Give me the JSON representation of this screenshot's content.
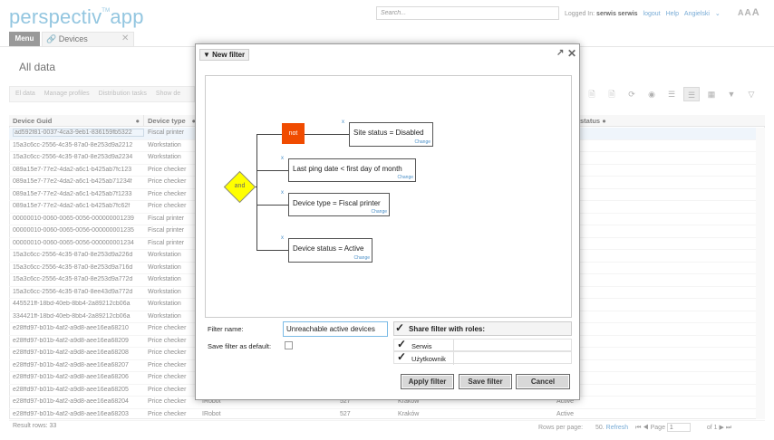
{
  "app": {
    "logo": "perspectiv",
    "logo_tm": "TM",
    "logo_suffix": "app"
  },
  "header": {
    "search_placeholder": "Search...",
    "logged_in_label": "Logged In:",
    "user": "serwis serwis",
    "logout": "logout",
    "help": "Help",
    "language": "Angielski",
    "font_sizes": [
      "A",
      "A",
      "A"
    ]
  },
  "nav": {
    "menu": "Menu",
    "tab": "Devices"
  },
  "page": {
    "title": "All data"
  },
  "toolbar": {
    "items": [
      "El data",
      "Manage profiles",
      "Distribution tasks",
      "Show de"
    ]
  },
  "grid": {
    "headers": [
      "Device Guid",
      "Device type",
      "",
      "",
      "",
      "status"
    ],
    "rows": [
      [
        "ad592f81-0037-4ca3-9eb1-836159fb5322",
        "Fiscal printer",
        "",
        "",
        "",
        ""
      ],
      [
        "15a3c6cc-2556-4c35-87a0-8e253d9a2212",
        "Workstation",
        "",
        "",
        "",
        ""
      ],
      [
        "15a3c6cc-2556-4c35-87a0-8e253d9a2234",
        "Workstation",
        "",
        "",
        "",
        ""
      ],
      [
        "089a15e7-77e2-4da2-a6c1-b425ab7fc123",
        "Price checker",
        "",
        "",
        "",
        ""
      ],
      [
        "089a15e7-77e2-4da2-a6c1-b425ab71234f",
        "Price checker",
        "",
        "",
        "",
        ""
      ],
      [
        "089a15e7-77e2-4da2-a6c1-b425ab7f1233",
        "Price checker",
        "",
        "",
        "",
        ""
      ],
      [
        "089a15e7-77e2-4da2-a6c1-b425ab7fc62f",
        "Price checker",
        "",
        "",
        "",
        ""
      ],
      [
        "00000010-0060-0065-0056-000000001239",
        "Fiscal printer",
        "",
        "",
        "",
        ""
      ],
      [
        "00000010-0060-0065-0056-000000001235",
        "Fiscal printer",
        "",
        "",
        "",
        ""
      ],
      [
        "00000010-0060-0065-0056-000000001234",
        "Fiscal printer",
        "",
        "",
        "",
        ""
      ],
      [
        "15a3c6cc-2556-4c35-87a0-8e253d9a226d",
        "Workstation",
        "",
        "",
        "",
        ""
      ],
      [
        "15a3c6cc-2556-4c35-87a0-8e253d9a716d",
        "Workstation",
        "",
        "",
        "",
        ""
      ],
      [
        "15a3c6cc-2556-4c35-87a0-8e253d9a772d",
        "Workstation",
        "",
        "",
        "",
        ""
      ],
      [
        "15a3c6cc-2556-4c35-87a0-8ee43d9a772d",
        "Workstation",
        "",
        "",
        "",
        ""
      ],
      [
        "445521ff-18bd-40eb-8bb4-2a89212cb06a",
        "Workstation",
        "",
        "",
        "",
        ""
      ],
      [
        "334421ff-18bd-40eb-8bb4-2a89212cb06a",
        "Workstation",
        "",
        "",
        "",
        ""
      ],
      [
        "e28ffd97-b01b-4af2-a9d8-aee16ea68210",
        "Price checker",
        "",
        "",
        "",
        ""
      ],
      [
        "e28ffd97-b01b-4af2-a9d8-aee16ea68209",
        "Price checker",
        "",
        "",
        "",
        ""
      ],
      [
        "e28ffd97-b01b-4af2-a9d8-aee16ea68208",
        "Price checker",
        "",
        "",
        "",
        ""
      ],
      [
        "e28ffd97-b01b-4af2-a9d8-aee16ea68207",
        "Price checker",
        "",
        "",
        "",
        ""
      ],
      [
        "e28ffd97-b01b-4af2-a9d8-aee16ea68206",
        "Price checker",
        "",
        "",
        "",
        ""
      ],
      [
        "e28ffd97-b01b-4af2-a9d8-aee16ea68205",
        "Price checker",
        "",
        "",
        "",
        ""
      ],
      [
        "e28ffd97-b01b-4af2-a9d8-aee16ea68204",
        "Price checker",
        "IRobot",
        "527",
        "Kraków",
        "Active"
      ],
      [
        "e28ffd97-b01b-4af2-a9d8-aee16ea68203",
        "Price checker",
        "IRobot",
        "527",
        "Kraków",
        "Active"
      ]
    ]
  },
  "footer": {
    "result_rows": "Result rows: 33",
    "rows_per_page_label": "Rows per page:",
    "rows_per_page": "50.",
    "refresh": "Refresh",
    "page_label": "Page",
    "page": "1",
    "of": "of 1"
  },
  "dialog": {
    "title": "New filter",
    "and_label": "and",
    "not_label": "not",
    "conditions": [
      {
        "text": "Site status = Disabled",
        "change": "Change"
      },
      {
        "text": "Last ping date < first day of month",
        "change": "Change"
      },
      {
        "text": "Device type = Fiscal printer",
        "change": "Change"
      },
      {
        "text": "Device status = Active",
        "change": "Change"
      }
    ],
    "remove_mark": "x",
    "filter_name_label": "Filter name:",
    "filter_name_value": "Unreachable active devices",
    "default_label": "Save filter as default:",
    "share_label": "Share filter with roles:",
    "roles": [
      "Serwis",
      "Użytkownik"
    ],
    "buttons": {
      "apply": "Apply filter",
      "save": "Save filter",
      "cancel": "Cancel"
    }
  }
}
